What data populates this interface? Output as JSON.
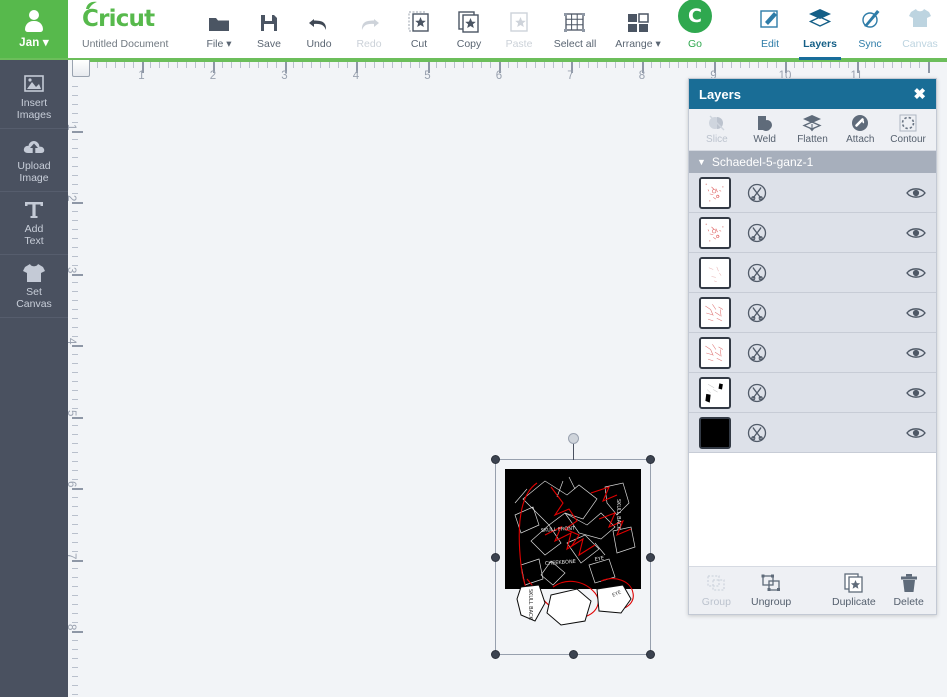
{
  "app": {
    "brand": "Cricut",
    "document_title": "Untitled Document"
  },
  "user": {
    "name": "Jan",
    "icon": "person-icon",
    "caret": "▾"
  },
  "toolbar": {
    "items": [
      {
        "label": "File",
        "icon": "folder-icon",
        "caret": "▾",
        "disabled": false
      },
      {
        "label": "Save",
        "icon": "floppy-disk-icon",
        "disabled": false
      },
      {
        "label": "Undo",
        "icon": "undo-arrow-icon",
        "disabled": false
      },
      {
        "label": "Redo",
        "icon": "redo-arrow-icon",
        "disabled": true
      },
      {
        "label": "Cut",
        "icon": "cut-icon",
        "disabled": false
      },
      {
        "label": "Copy",
        "icon": "copy-icon",
        "disabled": false
      },
      {
        "label": "Paste",
        "icon": "paste-icon",
        "disabled": true
      },
      {
        "label": "Select all",
        "icon": "select-all-grid-icon",
        "disabled": false
      },
      {
        "label": "Arrange",
        "icon": "arrange-icon",
        "caret": "▾",
        "disabled": false
      },
      {
        "label": "Go",
        "icon": "cricut-go-icon",
        "disabled": false
      }
    ]
  },
  "right_toolbar": {
    "items": [
      {
        "label": "Edit",
        "icon": "pencil-square-icon",
        "state": "normal"
      },
      {
        "label": "Layers",
        "icon": "layers-stack-icon",
        "state": "active"
      },
      {
        "label": "Sync",
        "icon": "sync-paint-icon",
        "state": "normal"
      },
      {
        "label": "Canvas",
        "icon": "tshirt-icon",
        "state": "disabled"
      }
    ]
  },
  "sidebar": {
    "items": [
      {
        "label": "Insert\nImages",
        "line1": "Insert",
        "line2": "Images",
        "icon": "insert-images-icon"
      },
      {
        "label": "Upload Image",
        "line1": "Upload",
        "line2": "Image",
        "icon": "upload-cloud-icon"
      },
      {
        "label": "Add Text",
        "line1": "Add",
        "line2": "Text",
        "icon": "text-t-icon"
      },
      {
        "label": "Set Canvas",
        "line1": "Set",
        "line2": "Canvas",
        "icon": "tshirt-icon"
      }
    ]
  },
  "rulers": {
    "horizontal_numbers": [
      1,
      2,
      3,
      4,
      5,
      6,
      7,
      8,
      9,
      10,
      11
    ],
    "vertical_numbers": [
      1,
      2,
      3,
      4,
      5,
      6,
      7,
      8
    ],
    "unit": "in"
  },
  "layers_panel": {
    "title": "Layers",
    "close_icon": "close-x-icon",
    "tools": [
      {
        "label": "Slice",
        "icon": "slice-icon",
        "disabled": true
      },
      {
        "label": "Weld",
        "icon": "weld-icon",
        "disabled": false
      },
      {
        "label": "Flatten",
        "icon": "flatten-icon",
        "disabled": false
      },
      {
        "label": "Attach",
        "icon": "attach-paperclip-icon",
        "disabled": false
      },
      {
        "label": "Contour",
        "icon": "contour-dashed-circle-icon",
        "disabled": false
      }
    ],
    "group": {
      "name": "Schaedel-5-ganz-1",
      "caret": "▼",
      "expanded": true
    },
    "layers": [
      {
        "thumb": "sparse-red-marks",
        "operation_icon": "cut-scissors-icon",
        "visibility_icon": "eye-icon",
        "visible": true
      },
      {
        "thumb": "sparse-red-marks",
        "operation_icon": "cut-scissors-icon",
        "visibility_icon": "eye-icon",
        "visible": true
      },
      {
        "thumb": "faint-marks",
        "operation_icon": "cut-scissors-icon",
        "visibility_icon": "eye-icon",
        "visible": true
      },
      {
        "thumb": "light-red-scatter",
        "operation_icon": "cut-scissors-icon",
        "visibility_icon": "eye-icon",
        "visible": true
      },
      {
        "thumb": "light-red-scatter",
        "operation_icon": "cut-scissors-icon",
        "visibility_icon": "eye-icon",
        "visible": true
      },
      {
        "thumb": "black-shapes",
        "operation_icon": "cut-scissors-icon",
        "visibility_icon": "eye-icon",
        "visible": true
      },
      {
        "thumb": "solid-black",
        "operation_icon": "cut-scissors-icon",
        "visibility_icon": "eye-icon",
        "visible": true
      }
    ],
    "bottom_tools": [
      {
        "label": "Group",
        "icon": "group-icon",
        "disabled": true
      },
      {
        "label": "Ungroup",
        "icon": "ungroup-icon",
        "disabled": false
      },
      {
        "label": "Duplicate",
        "icon": "duplicate-icon",
        "disabled": false
      },
      {
        "label": "Delete",
        "icon": "trash-icon",
        "disabled": false
      }
    ]
  },
  "canvas": {
    "selection": {
      "selected": true,
      "rotate_handle": "rotate-handle",
      "artwork_labels": [
        "SKULL FRONT",
        "SKULL BACK",
        "CHEEKBONE",
        "EYE",
        "SKULL BACK",
        "EYE"
      ]
    }
  }
}
